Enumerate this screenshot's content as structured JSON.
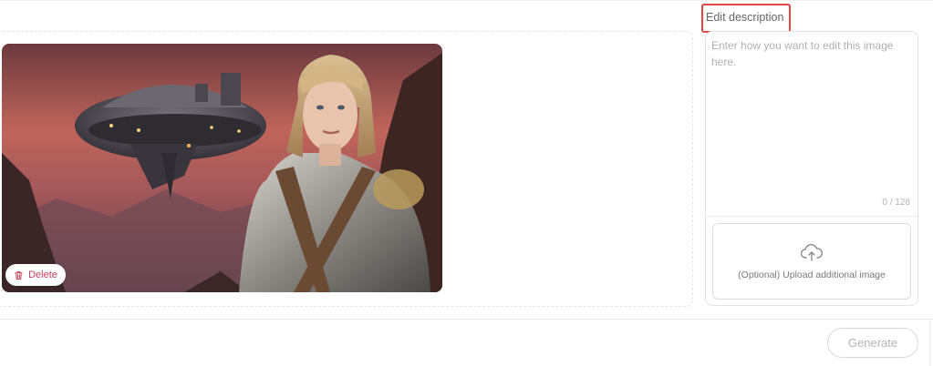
{
  "editor": {
    "image": {
      "alt": "Woman in plate armor in front of a floating airship on a red sky",
      "delete_label": "Delete"
    },
    "description": {
      "label": "Edit description",
      "placeholder": "Enter how you want to edit this image here.",
      "value": "",
      "char_count": "0 / 128",
      "upload_label": "(Optional) Upload additional image"
    },
    "footer": {
      "generate_label": "Generate"
    }
  },
  "colors": {
    "highlight_border": "#e04848",
    "delete_accent": "#c9405a",
    "disabled_text": "#b5b5b5"
  },
  "icons": {
    "delete": "trash-icon",
    "upload": "cloud-upload-icon"
  }
}
